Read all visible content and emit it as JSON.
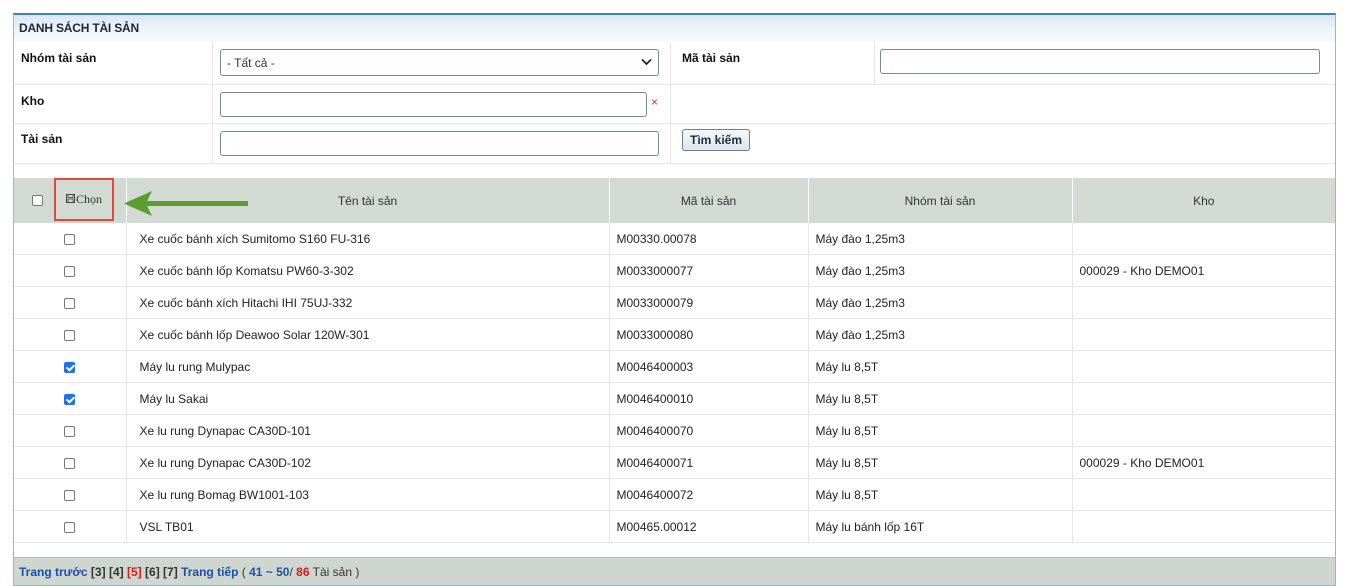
{
  "panel": {
    "title": "DANH SÁCH TÀI SẢN"
  },
  "filters": {
    "group_label": "Nhóm tài sản",
    "group_selected": "- Tất cả -",
    "code_label": "Mã tài sản",
    "code_value": "",
    "warehouse_label": "Kho",
    "warehouse_value": "",
    "clear_symbol": "×",
    "asset_label": "Tài sản",
    "asset_value": "",
    "search_button": "Tìm kiếm"
  },
  "table": {
    "select_label": "Chọn",
    "columns": [
      "Tên tài sản",
      "Mã tài sản",
      "Nhóm tài sản",
      "Kho"
    ],
    "rows": [
      {
        "checked": false,
        "name": "Xe cuốc bánh xích Sumitomo S160 FU-316",
        "code": "M00330.00078",
        "group": "Máy đào 1,25m3",
        "warehouse": ""
      },
      {
        "checked": false,
        "name": "Xe cuốc bánh lốp Komatsu PW60-3-302",
        "code": "M0033000077",
        "group": "Máy đào 1,25m3",
        "warehouse": "000029 - Kho DEMO01"
      },
      {
        "checked": false,
        "name": "Xe cuốc bánh xích Hitachi IHI 75UJ-332",
        "code": "M0033000079",
        "group": "Máy đào 1,25m3",
        "warehouse": ""
      },
      {
        "checked": false,
        "name": "Xe cuốc bánh lốp Deawoo Solar 120W-301",
        "code": "M0033000080",
        "group": "Máy đào 1,25m3",
        "warehouse": ""
      },
      {
        "checked": true,
        "name": "Máy lu rung Mulypac",
        "code": "M0046400003",
        "group": "Máy lu 8,5T",
        "warehouse": ""
      },
      {
        "checked": true,
        "name": "Máy lu Sakai",
        "code": "M0046400010",
        "group": "Máy lu 8,5T",
        "warehouse": ""
      },
      {
        "checked": false,
        "name": "Xe lu rung Dynapac CA30D-101",
        "code": "M0046400070",
        "group": "Máy lu 8,5T",
        "warehouse": ""
      },
      {
        "checked": false,
        "name": "Xe lu rung Dynapac CA30D-102",
        "code": "M0046400071",
        "group": "Máy lu 8,5T",
        "warehouse": "000029 - Kho DEMO01"
      },
      {
        "checked": false,
        "name": "Xe lu rung Bomag BW1001-103",
        "code": "M0046400072",
        "group": "Máy lu 8,5T",
        "warehouse": ""
      },
      {
        "checked": false,
        "name": "VSL TB01",
        "code": "M00465.00012",
        "group": "Máy lu bánh lốp 16T",
        "warehouse": ""
      }
    ]
  },
  "pager": {
    "prev": "Trang trước",
    "pages": [
      "3",
      "4",
      "5",
      "6",
      "7"
    ],
    "current": "5",
    "next": "Trang tiếp",
    "range": "41 ~ 50",
    "total": "86",
    "unit": "Tài sản"
  },
  "colors": {
    "accent": "#4a7fa8",
    "header_bg": "#d3d9d3",
    "highlight": "#e04a3a",
    "arrow": "#5a9e2f",
    "checked": "#1a73e8"
  }
}
